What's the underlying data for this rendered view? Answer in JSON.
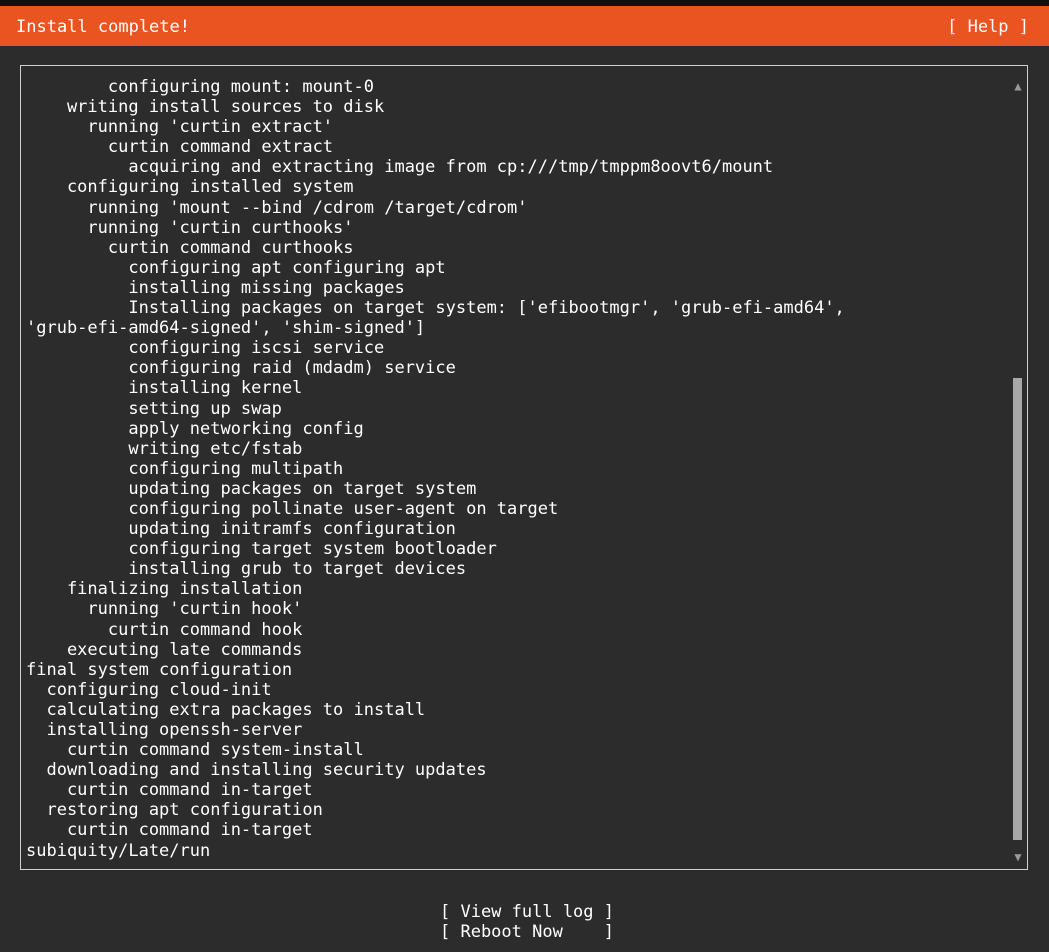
{
  "header": {
    "title": "Install complete!",
    "help_label": "[ Help ]"
  },
  "log": {
    "lines": [
      "        configuring mount: mount-0",
      "    writing install sources to disk",
      "      running 'curtin extract'",
      "        curtin command extract",
      "          acquiring and extracting image from cp:///tmp/tmppm8oovt6/mount",
      "    configuring installed system",
      "      running 'mount --bind /cdrom /target/cdrom'",
      "      running 'curtin curthooks'",
      "        curtin command curthooks",
      "          configuring apt configuring apt",
      "          installing missing packages",
      "          Installing packages on target system: ['efibootmgr', 'grub-efi-amd64',",
      "'grub-efi-amd64-signed', 'shim-signed']",
      "          configuring iscsi service",
      "          configuring raid (mdadm) service",
      "          installing kernel",
      "          setting up swap",
      "          apply networking config",
      "          writing etc/fstab",
      "          configuring multipath",
      "          updating packages on target system",
      "          configuring pollinate user-agent on target",
      "          updating initramfs configuration",
      "          configuring target system bootloader",
      "          installing grub to target devices",
      "    finalizing installation",
      "      running 'curtin hook'",
      "        curtin command hook",
      "    executing late commands",
      "final system configuration",
      "  configuring cloud-init",
      "  calculating extra packages to install",
      "  installing openssh-server",
      "    curtin command system-install",
      "  downloading and installing security updates",
      "    curtin command in-target",
      "  restoring apt configuration",
      "    curtin command in-target",
      "subiquity/Late/run"
    ],
    "scroll_up_icon": "triangle-up-icon",
    "scroll_down_icon": "triangle-down-icon"
  },
  "actions": {
    "view_full_log": "[ View full log ]",
    "reboot_now": "[ Reboot Now    ]"
  },
  "colors": {
    "background": "#2c2c2c",
    "title_bar": "#e95420",
    "text": "#ffffff",
    "scroll_thumb": "#a8a8a8"
  }
}
